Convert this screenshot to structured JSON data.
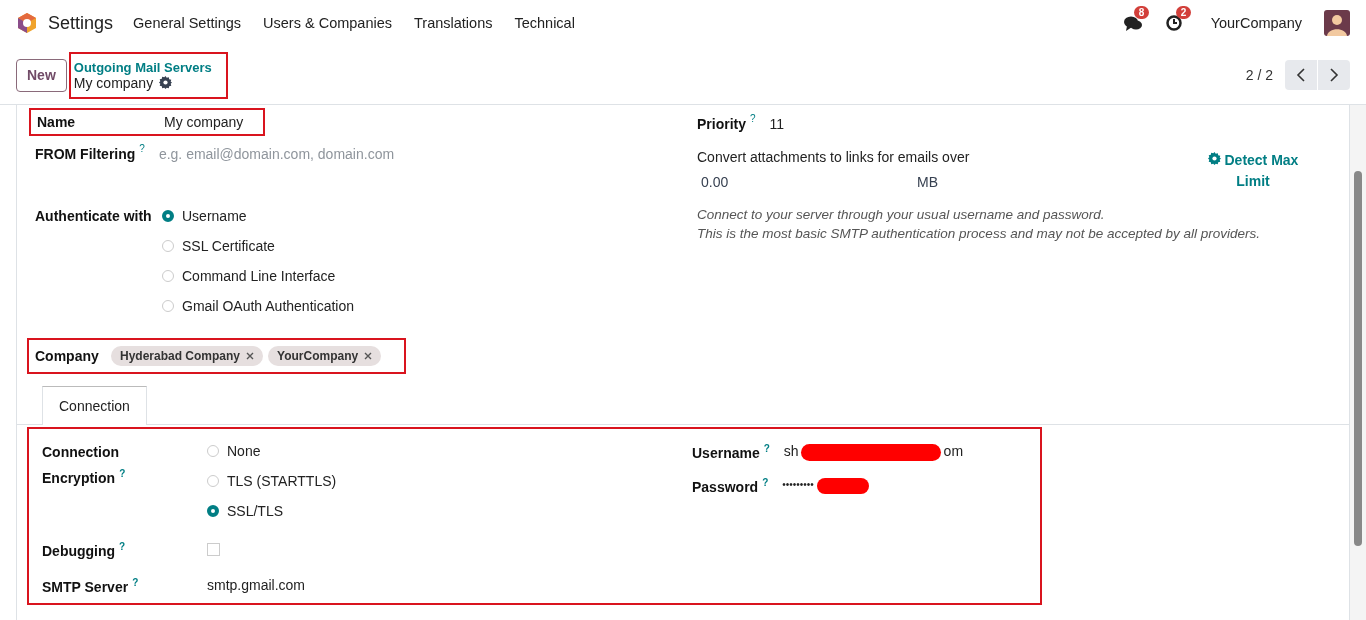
{
  "navbar": {
    "app_name": "Settings",
    "menu": [
      "General Settings",
      "Users & Companies",
      "Translations",
      "Technical"
    ],
    "messages_count": "8",
    "activities_count": "2",
    "company": "YourCompany"
  },
  "control_panel": {
    "new_button": "New",
    "breadcrumb": {
      "parent": "Outgoing Mail Servers",
      "current": "My company",
      "highlighted": true
    },
    "pager": "2 / 2"
  },
  "form": {
    "name": {
      "label": "Name",
      "value": "My company",
      "highlighted": true
    },
    "from_filtering": {
      "label": "FROM Filtering",
      "help": "?",
      "placeholder": "e.g. email@domain.com, domain.com"
    },
    "authenticate": {
      "label": "Authenticate with",
      "options": [
        {
          "label": "Username",
          "selected": true
        },
        {
          "label": "SSL Certificate",
          "selected": false
        },
        {
          "label": "Command Line Interface",
          "selected": false
        },
        {
          "label": "Gmail OAuth Authentication",
          "selected": false
        }
      ]
    },
    "company": {
      "label": "Company",
      "highlighted": true,
      "tags": [
        "Hyderabad Company",
        "YourCompany"
      ]
    },
    "priority": {
      "label": "Priority",
      "help": "?",
      "value": "11"
    },
    "attachments": {
      "label": "Convert attachments to links for emails over",
      "value": "0.00",
      "unit": "MB",
      "button": "Detect Max Limit"
    },
    "auth_help": [
      "Connect to your server through your usual username and password.",
      "This is the most basic SMTP authentication process and may not be accepted by all providers."
    ],
    "tabs": [
      {
        "label": "Connection",
        "selected": true
      }
    ],
    "connection": {
      "highlighted": true,
      "encryption": {
        "label": "Connection Encryption",
        "help": "?",
        "options": [
          {
            "label": "None",
            "selected": false
          },
          {
            "label": "TLS (STARTTLS)",
            "selected": false
          },
          {
            "label": "SSL/TLS",
            "selected": true
          }
        ]
      },
      "debugging": {
        "label": "Debugging",
        "help": "?",
        "checked": false
      },
      "smtp_server": {
        "label": "SMTP Server",
        "help": "?",
        "value": "smtp.gmail.com"
      },
      "username": {
        "label": "Username",
        "help": "?",
        "value_start": "sh",
        "value_end": "om",
        "redacted": true
      },
      "password": {
        "label": "Password",
        "help": "?",
        "value": "•••••••••",
        "redacted": true
      }
    }
  }
}
